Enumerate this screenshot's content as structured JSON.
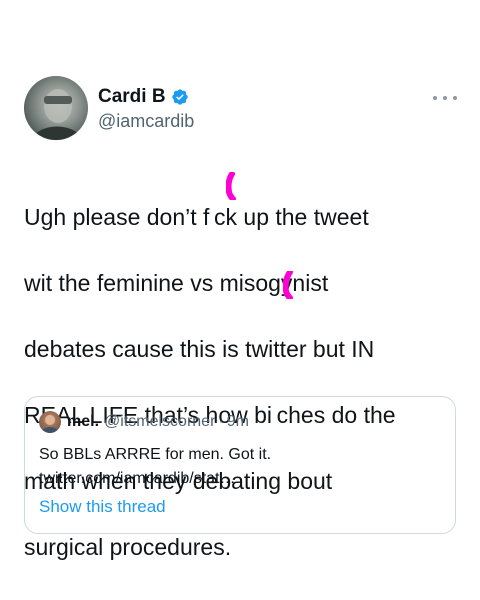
{
  "author": {
    "display_name": "Cardi B",
    "handle": "@iamcardib",
    "verified": true,
    "avatar_icon": "profile-photo"
  },
  "menu": {
    "icon": "more-horizontal-icon"
  },
  "tweet": {
    "lines": [
      "Ugh please don’t f ck up the tweet",
      "wit the feminine vs misogynist",
      "debates cause this is twitter but IN",
      "REAL LIFE that’s how bi ches do the",
      "math when they debating bout",
      "surgical procedures."
    ]
  },
  "quote": {
    "name": "mel.",
    "handle": "@itsmelscorner",
    "separator": "·",
    "time": "9m",
    "text": "So BBLs ARRRE for men. Got it. twitter.com/iamcardib/stat…",
    "thread_link": "Show this thread"
  },
  "colors": {
    "text": "#0f1419",
    "secondary": "#536471",
    "link": "#1d9bf0",
    "verified": "#1d9bf0",
    "censor_mark": "#ff00d4",
    "border": "#cfd9de"
  }
}
